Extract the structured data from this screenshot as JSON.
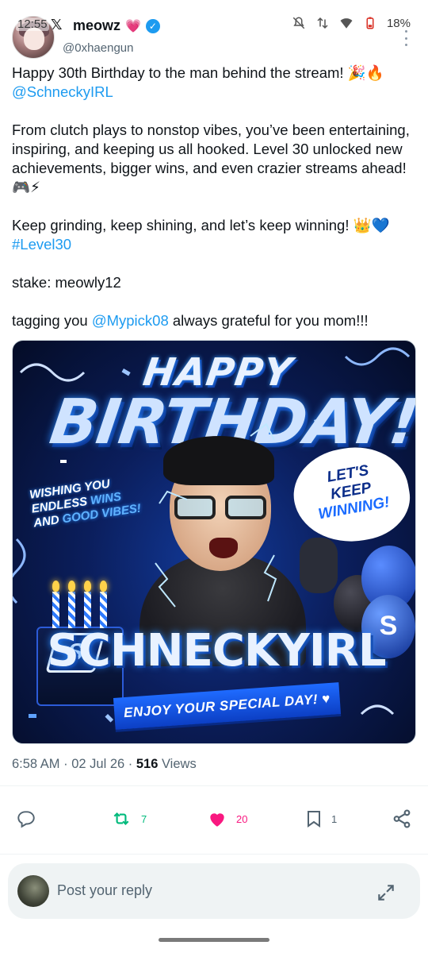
{
  "status_bar": {
    "time": "12:55",
    "battery": "18%"
  },
  "app": {
    "logo": "𝕏"
  },
  "author": {
    "display_name": "meowz",
    "name_emoji": "💗",
    "handle": "@0xhaengun"
  },
  "tweet": {
    "p1_text": "Happy 30th Birthday to the man behind the stream! 🎉🔥 ",
    "p1_link": "@SchneckyIRL",
    "p2_text": "From clutch plays to nonstop vibes, you’ve been entertaining, inspiring, and keeping us all hooked. Level 30 unlocked new achievements, bigger wins, and even crazier streams ahead! 🎮⚡",
    "p3_text": "Keep grinding, keep shining, and let’s keep winning! 👑💙 ",
    "p3_link": "#Level30",
    "p4_text": "stake: meowly12",
    "p5_prefix": "tagging you ",
    "p5_link": "@Mypick08",
    "p5_suffix": " always grateful for you mom!!!"
  },
  "image": {
    "happy": "HAPPY",
    "birthday": "BIRTHDAY!",
    "bubble_left_1": "WISHING YOU",
    "bubble_left_2a": "ENDLESS ",
    "bubble_left_2b": "WINS",
    "bubble_left_3a": "AND ",
    "bubble_left_3b": "GOOD VIBES!",
    "bubble_right_1": "LET'S",
    "bubble_right_2": "KEEP",
    "bubble_right_3": "WINNING!",
    "brand": "SCHNECKYIRL",
    "brand_logo": "S",
    "ribbon": "ENJOY YOUR SPECIAL DAY! ♥"
  },
  "meta": {
    "time": "6:58 AM",
    "sep1": " · ",
    "date": "02 Jul 26",
    "sep2": " · ",
    "views_count": "516",
    "views_label": " Views"
  },
  "actions": {
    "reposts": "7",
    "likes": "20",
    "bookmarks": "1",
    "colors": {
      "repost": "#00ba7c",
      "like": "#f91880",
      "default": "#536471"
    }
  },
  "reply": {
    "placeholder": "Post your reply"
  }
}
